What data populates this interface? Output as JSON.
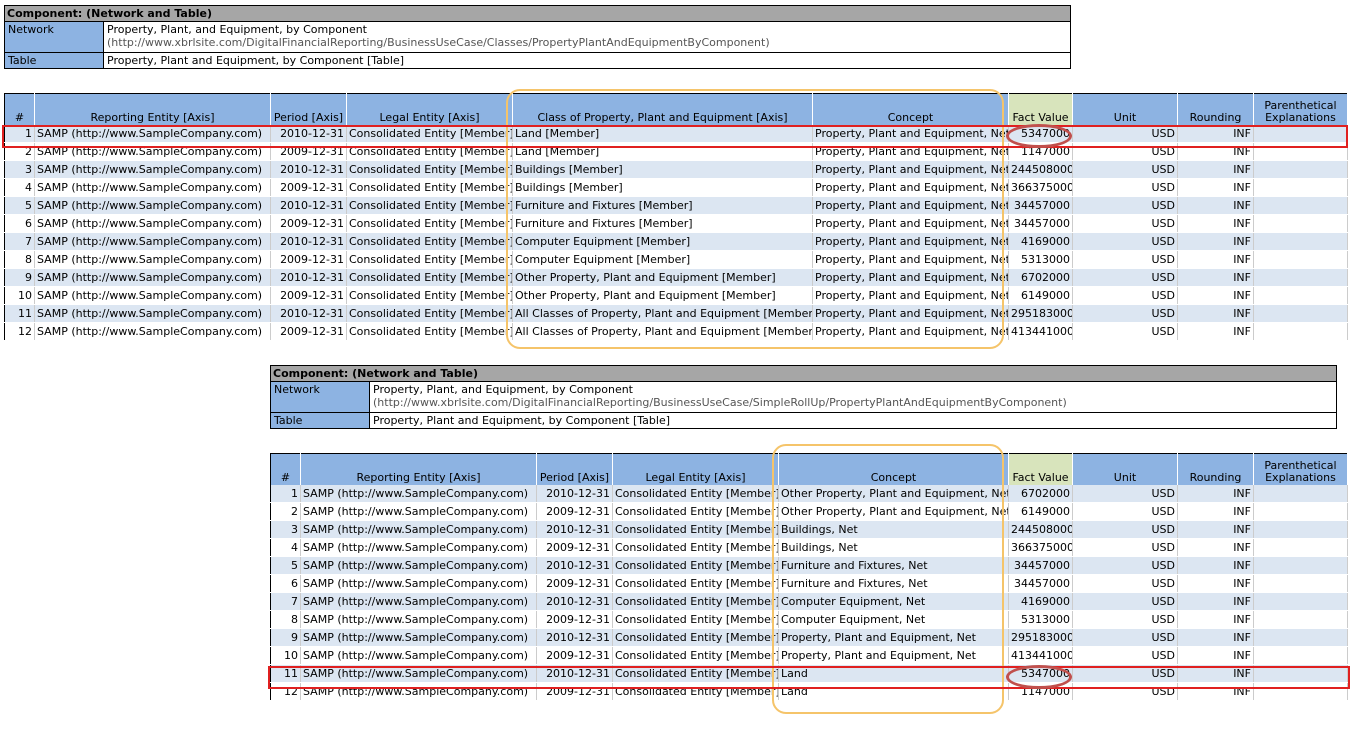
{
  "component1": {
    "title": "Component: (Network and Table)",
    "network_label": "Network",
    "network_value": "Property, Plant, and Equipment, by Component",
    "network_url": "(http://www.xbrlsite.com/DigitalFinancialReporting/BusinessUseCase/Classes/PropertyPlantAndEquipmentByComponent)",
    "table_label": "Table",
    "table_value": "Property, Plant and Equipment, by Component [Table]"
  },
  "table1": {
    "headers": [
      "#",
      "Reporting Entity [Axis]",
      "Period [Axis]",
      "Legal Entity [Axis]",
      "Class of Property, Plant and Equipment [Axis]",
      "Concept",
      "Fact Value",
      "Unit",
      "Rounding",
      "Parenthetical Explanations"
    ],
    "rows": [
      [
        "1",
        "SAMP (http://www.SampleCompany.com)",
        "2010-12-31",
        "Consolidated Entity [Member]",
        "Land [Member]",
        "Property, Plant and Equipment, Net",
        "5347000",
        "USD",
        "INF",
        ""
      ],
      [
        "2",
        "SAMP (http://www.SampleCompany.com)",
        "2009-12-31",
        "Consolidated Entity [Member]",
        "Land [Member]",
        "Property, Plant and Equipment, Net",
        "1147000",
        "USD",
        "INF",
        ""
      ],
      [
        "3",
        "SAMP (http://www.SampleCompany.com)",
        "2010-12-31",
        "Consolidated Entity [Member]",
        "Buildings [Member]",
        "Property, Plant and Equipment, Net",
        "244508000",
        "USD",
        "INF",
        ""
      ],
      [
        "4",
        "SAMP (http://www.SampleCompany.com)",
        "2009-12-31",
        "Consolidated Entity [Member]",
        "Buildings [Member]",
        "Property, Plant and Equipment, Net",
        "366375000",
        "USD",
        "INF",
        ""
      ],
      [
        "5",
        "SAMP (http://www.SampleCompany.com)",
        "2010-12-31",
        "Consolidated Entity [Member]",
        "Furniture and Fixtures [Member]",
        "Property, Plant and Equipment, Net",
        "34457000",
        "USD",
        "INF",
        ""
      ],
      [
        "6",
        "SAMP (http://www.SampleCompany.com)",
        "2009-12-31",
        "Consolidated Entity [Member]",
        "Furniture and Fixtures [Member]",
        "Property, Plant and Equipment, Net",
        "34457000",
        "USD",
        "INF",
        ""
      ],
      [
        "7",
        "SAMP (http://www.SampleCompany.com)",
        "2010-12-31",
        "Consolidated Entity [Member]",
        "Computer Equipment [Member]",
        "Property, Plant and Equipment, Net",
        "4169000",
        "USD",
        "INF",
        ""
      ],
      [
        "8",
        "SAMP (http://www.SampleCompany.com)",
        "2009-12-31",
        "Consolidated Entity [Member]",
        "Computer Equipment [Member]",
        "Property, Plant and Equipment, Net",
        "5313000",
        "USD",
        "INF",
        ""
      ],
      [
        "9",
        "SAMP (http://www.SampleCompany.com)",
        "2010-12-31",
        "Consolidated Entity [Member]",
        "Other Property, Plant and Equipment [Member]",
        "Property, Plant and Equipment, Net",
        "6702000",
        "USD",
        "INF",
        ""
      ],
      [
        "10",
        "SAMP (http://www.SampleCompany.com)",
        "2009-12-31",
        "Consolidated Entity [Member]",
        "Other Property, Plant and Equipment [Member]",
        "Property, Plant and Equipment, Net",
        "6149000",
        "USD",
        "INF",
        ""
      ],
      [
        "11",
        "SAMP (http://www.SampleCompany.com)",
        "2010-12-31",
        "Consolidated Entity [Member]",
        "All Classes of Property, Plant and Equipment [Member]",
        "Property, Plant and Equipment, Net",
        "295183000",
        "USD",
        "INF",
        ""
      ],
      [
        "12",
        "SAMP (http://www.SampleCompany.com)",
        "2009-12-31",
        "Consolidated Entity [Member]",
        "All Classes of Property, Plant and Equipment [Member]",
        "Property, Plant and Equipment, Net",
        "413441000",
        "USD",
        "INF",
        ""
      ]
    ]
  },
  "component2": {
    "title": "Component: (Network and Table)",
    "network_label": "Network",
    "network_value": "Property, Plant, and Equipment, by Component",
    "network_url": "(http://www.xbrlsite.com/DigitalFinancialReporting/BusinessUseCase/SimpleRollUp/PropertyPlantAndEquipmentByComponent)",
    "table_label": "Table",
    "table_value": "Property, Plant and Equipment, by Component [Table]"
  },
  "table2": {
    "headers": [
      "#",
      "Reporting Entity [Axis]",
      "Period [Axis]",
      "Legal Entity [Axis]",
      "Concept",
      "Fact Value",
      "Unit",
      "Rounding",
      "Parenthetical Explanations"
    ],
    "rows": [
      [
        "1",
        "SAMP (http://www.SampleCompany.com)",
        "2010-12-31",
        "Consolidated Entity [Member]",
        "Other Property, Plant and Equipment, Net",
        "6702000",
        "USD",
        "INF",
        ""
      ],
      [
        "2",
        "SAMP (http://www.SampleCompany.com)",
        "2009-12-31",
        "Consolidated Entity [Member]",
        "Other Property, Plant and Equipment, Net",
        "6149000",
        "USD",
        "INF",
        ""
      ],
      [
        "3",
        "SAMP (http://www.SampleCompany.com)",
        "2010-12-31",
        "Consolidated Entity [Member]",
        "Buildings, Net",
        "244508000",
        "USD",
        "INF",
        ""
      ],
      [
        "4",
        "SAMP (http://www.SampleCompany.com)",
        "2009-12-31",
        "Consolidated Entity [Member]",
        "Buildings, Net",
        "366375000",
        "USD",
        "INF",
        ""
      ],
      [
        "5",
        "SAMP (http://www.SampleCompany.com)",
        "2010-12-31",
        "Consolidated Entity [Member]",
        "Furniture and Fixtures, Net",
        "34457000",
        "USD",
        "INF",
        ""
      ],
      [
        "6",
        "SAMP (http://www.SampleCompany.com)",
        "2009-12-31",
        "Consolidated Entity [Member]",
        "Furniture and Fixtures, Net",
        "34457000",
        "USD",
        "INF",
        ""
      ],
      [
        "7",
        "SAMP (http://www.SampleCompany.com)",
        "2010-12-31",
        "Consolidated Entity [Member]",
        "Computer Equipment, Net",
        "4169000",
        "USD",
        "INF",
        ""
      ],
      [
        "8",
        "SAMP (http://www.SampleCompany.com)",
        "2009-12-31",
        "Consolidated Entity [Member]",
        "Computer Equipment, Net",
        "5313000",
        "USD",
        "INF",
        ""
      ],
      [
        "9",
        "SAMP (http://www.SampleCompany.com)",
        "2010-12-31",
        "Consolidated Entity [Member]",
        "Property, Plant and Equipment, Net",
        "295183000",
        "USD",
        "INF",
        ""
      ],
      [
        "10",
        "SAMP (http://www.SampleCompany.com)",
        "2009-12-31",
        "Consolidated Entity [Member]",
        "Property, Plant and Equipment, Net",
        "413441000",
        "USD",
        "INF",
        ""
      ],
      [
        "11",
        "SAMP (http://www.SampleCompany.com)",
        "2010-12-31",
        "Consolidated Entity [Member]",
        "Land",
        "5347000",
        "USD",
        "INF",
        ""
      ],
      [
        "12",
        "SAMP (http://www.SampleCompany.com)",
        "2009-12-31",
        "Consolidated Entity [Member]",
        "Land",
        "1147000",
        "USD",
        "INF",
        ""
      ]
    ]
  },
  "colors": {
    "header_blue": "#8db3e2",
    "row_blue": "#dce6f2",
    "fact_header": "#d8e4bc",
    "highlight_red": "#e02020",
    "circle_red": "#c0504d",
    "highlight_yellow": "#f5c46a"
  }
}
